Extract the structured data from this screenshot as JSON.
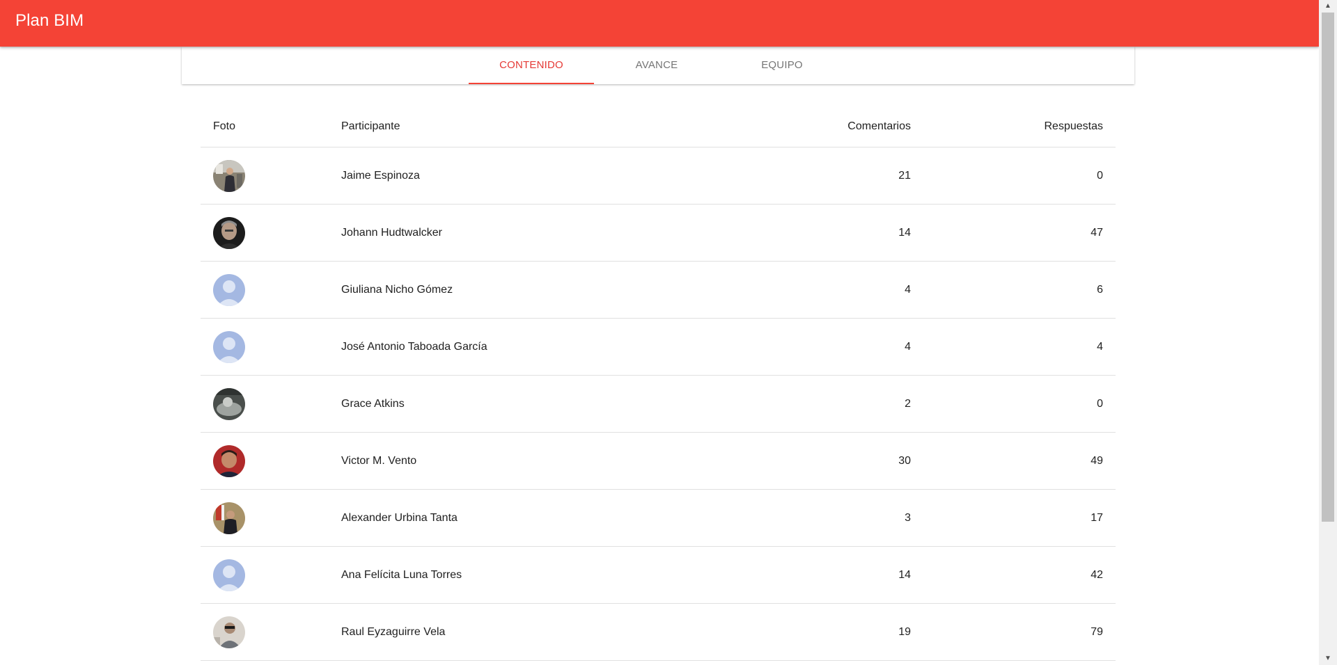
{
  "app": {
    "title": "Plan BIM"
  },
  "tabs": [
    {
      "label": "CONTENIDO",
      "active": true
    },
    {
      "label": "AVANCE",
      "active": false
    },
    {
      "label": "EQUIPO",
      "active": false
    }
  ],
  "table": {
    "headers": {
      "foto": "Foto",
      "participante": "Participante",
      "comentarios": "Comentarios",
      "respuestas": "Respuestas"
    },
    "rows": [
      {
        "name": "Jaime Espinoza",
        "comentarios": "21",
        "respuestas": "0",
        "avatar": "photo-person-suit"
      },
      {
        "name": "Johann Hudtwalcker",
        "comentarios": "14",
        "respuestas": "47",
        "avatar": "photo-man-portrait"
      },
      {
        "name": "Giuliana Nicho Gómez",
        "comentarios": "4",
        "respuestas": "6",
        "avatar": "default-user-icon"
      },
      {
        "name": "José Antonio Taboada García",
        "comentarios": "4",
        "respuestas": "4",
        "avatar": "default-user-icon"
      },
      {
        "name": "Grace Atkins",
        "comentarios": "2",
        "respuestas": "0",
        "avatar": "photo-dark-grey"
      },
      {
        "name": "Victor M. Vento",
        "comentarios": "30",
        "respuestas": "49",
        "avatar": "photo-man-red-background"
      },
      {
        "name": "Alexander Urbina Tanta",
        "comentarios": "3",
        "respuestas": "17",
        "avatar": "photo-man-flag"
      },
      {
        "name": "Ana Felícita Luna Torres",
        "comentarios": "14",
        "respuestas": "42",
        "avatar": "default-user-icon"
      },
      {
        "name": "Raul Eyzaguirre Vela",
        "comentarios": "19",
        "respuestas": "79",
        "avatar": "photo-man-sunglasses"
      }
    ]
  },
  "colors": {
    "app_bar": "#f44336",
    "tab_active": "#e53935",
    "tab_inactive": "#757575",
    "default_avatar": "#a4b8e2"
  }
}
